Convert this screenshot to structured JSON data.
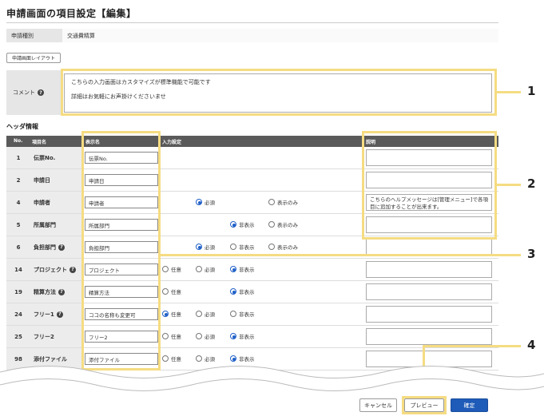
{
  "page": {
    "title": "申請画面の項目設定【編集】"
  },
  "application_type": {
    "label": "申請種別",
    "value": "交通費精算"
  },
  "layout_button": {
    "label": "申請画面レイアウト"
  },
  "comment": {
    "label": "コメント",
    "help": "?",
    "line1": "こちらの入力画面はカスタマイズが標準機能で可能です",
    "line2": "詳細はお気軽にお声掛けくださいませ"
  },
  "header_section": {
    "title": "ヘッダ情報"
  },
  "table": {
    "headers": {
      "no": "No.",
      "name": "項目名",
      "display": "表示名",
      "input": "入力設定",
      "desc": "説明"
    },
    "rows": [
      {
        "no": "1",
        "name": "伝票No.",
        "display": "伝票No.",
        "help": false,
        "options": [],
        "desc": ""
      },
      {
        "no": "2",
        "name": "申請日",
        "display": "申請日",
        "help": false,
        "options": [],
        "desc": ""
      },
      {
        "no": "4",
        "name": "申請者",
        "display": "申請者",
        "help": false,
        "options": [
          {
            "label": "必須",
            "on": true,
            "slot": 1
          },
          {
            "label": "表示のみ",
            "on": false,
            "slot": 3
          }
        ],
        "desc": "こちらのヘルプメッセージは[管理メニュー]で各項目に追加することが出来ます。"
      },
      {
        "no": "5",
        "name": "所属部門",
        "display": "所属部門",
        "help": false,
        "options": [
          {
            "label": "非表示",
            "on": true,
            "slot": 2
          },
          {
            "label": "表示のみ",
            "on": false,
            "slot": 3
          }
        ],
        "desc": ""
      },
      {
        "no": "6",
        "name": "負担部門",
        "display": "負担部門",
        "help": true,
        "options": [
          {
            "label": "必須",
            "on": true,
            "slot": 1
          },
          {
            "label": "非表示",
            "on": false,
            "slot": 2
          },
          {
            "label": "表示のみ",
            "on": false,
            "slot": 3
          }
        ],
        "desc": ""
      },
      {
        "no": "14",
        "name": "プロジェクト",
        "display": "プロジェクト",
        "help": true,
        "options": [
          {
            "label": "任意",
            "on": false,
            "slot": 0
          },
          {
            "label": "必須",
            "on": false,
            "slot": 1
          },
          {
            "label": "非表示",
            "on": true,
            "slot": 2
          }
        ],
        "desc": ""
      },
      {
        "no": "19",
        "name": "精算方法",
        "display": "精算方法",
        "help": true,
        "options": [
          {
            "label": "任意",
            "on": false,
            "slot": 0
          },
          {
            "label": "非表示",
            "on": true,
            "slot": 2
          }
        ],
        "desc": ""
      },
      {
        "no": "24",
        "name": "フリー1",
        "display": "ココの名称も変更可",
        "help": true,
        "options": [
          {
            "label": "任意",
            "on": true,
            "slot": 0
          },
          {
            "label": "必須",
            "on": false,
            "slot": 1
          },
          {
            "label": "非表示",
            "on": false,
            "slot": 2
          }
        ],
        "desc": ""
      },
      {
        "no": "25",
        "name": "フリー2",
        "display": "フリー2",
        "help": false,
        "options": [
          {
            "label": "任意",
            "on": false,
            "slot": 0
          },
          {
            "label": "必須",
            "on": false,
            "slot": 1
          },
          {
            "label": "非表示",
            "on": true,
            "slot": 2
          }
        ],
        "desc": ""
      },
      {
        "no": "98",
        "name": "添付ファイル",
        "display": "添付ファイル",
        "help": false,
        "options": [
          {
            "label": "任意",
            "on": false,
            "slot": 0
          },
          {
            "label": "必須",
            "on": false,
            "slot": 1
          },
          {
            "label": "非表示",
            "on": true,
            "slot": 2
          }
        ],
        "desc": ""
      }
    ]
  },
  "callouts": [
    "1",
    "2",
    "3",
    "4"
  ],
  "footer": {
    "cancel": "キャンセル",
    "preview": "プレビュー",
    "confirm": "確定"
  },
  "colors": {
    "highlight": "#f5dc82",
    "primary": "#1f5bb8",
    "table_header": "#5a5a5a",
    "radio_on": "#2060c8"
  }
}
